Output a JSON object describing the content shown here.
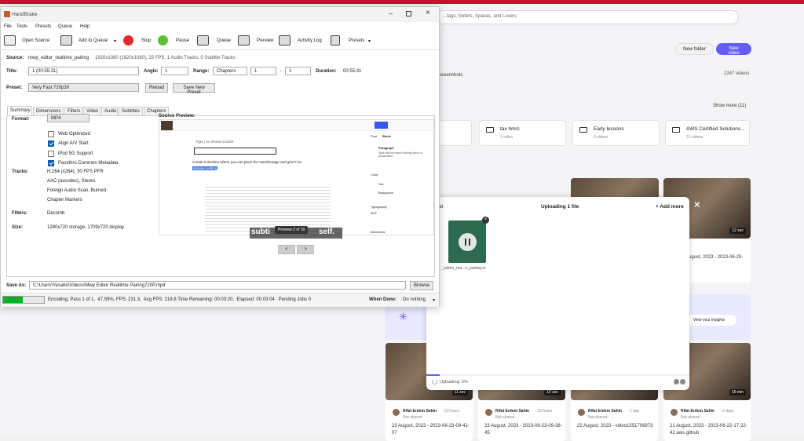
{
  "bg": {
    "search_placeholder": "...tags, folders, Spaces, and Lovers",
    "new_folder": "New folder",
    "new_video": "New video",
    "screenshots_label": "creenshots",
    "videos_count": "2247 videos",
    "show_more": "Show more (11)",
    "folders": [
      {
        "name": "tax hmrc",
        "sub": "1 video"
      },
      {
        "name": "Early lessons",
        "sub": "0 videos"
      },
      {
        "name": "AWS Certified Solutions...",
        "sub": "21 videos"
      }
    ],
    "insights": "View your insights",
    "mid_cards": [
      {
        "dur": "12 sec",
        "date": "August, 2023 - 2023-06-23-"
      }
    ],
    "bottom_cards": [
      {
        "dur": "11 sec",
        "author": "Rifat Erdem Sahin",
        "ago": "· 23 hours",
        "shared": "Not shared",
        "title": "23 August, 2023 - 2023-06-23-09-42-07"
      },
      {
        "dur": "10 sec",
        "author": "Rifat Erdem Sahin",
        "ago": "· 23 hours",
        "shared": "Not shared",
        "title": "23 August, 2023 - 2023-06-23-09-38-45"
      },
      {
        "dur": "",
        "author": "Rifat Erdem Sahin",
        "ago": "· 1 day",
        "shared": "Not shared",
        "title": "22 August, 2023 - video1551706973"
      },
      {
        "dur": "16 min",
        "author": "Rifat Erdem Sahin",
        "ago": "· 2 days",
        "shared": "Not shared",
        "title": "21 August, 2023 - 2023-06-22-17-22-42 aws github"
      }
    ]
  },
  "upload": {
    "cancel": "cel",
    "title": "Uploading 1 file",
    "add_more": "+ Add more",
    "filename": "_editor_rea...e_pairing.m",
    "status": "Uploading: 5%",
    "progress": 0.05,
    "close": "×"
  },
  "hb": {
    "title": "HandBrake",
    "menu": [
      "File",
      "Tools",
      "Presets",
      "Queue",
      "Help"
    ],
    "toolbar": {
      "open_source": "Open Source",
      "add_to_queue": "Add to Queue",
      "stop": "Stop",
      "pause": "Pause",
      "queue": "Queue",
      "preview": "Preview",
      "activity_log": "Activity Log",
      "presets": "Presets"
    },
    "source_label": "Source:",
    "source_name": "mwp_editor_realtime_pairing",
    "source_info": "1920x1080 (1920x1080), 25 FPS, 1 Audio Tracks, 0 Subtitle Tracks",
    "title_label": "Title:",
    "title_value": "1 (00:55:31)",
    "angle_label": "Angle:",
    "angle_value": "1",
    "range_label": "Range:",
    "range_type": "Chapters",
    "range_from": "1",
    "range_dash": "-",
    "range_to": "1",
    "duration_label": "Duration:",
    "duration_value": "00:55:31",
    "preset_label": "Preset:",
    "preset_value": "Very Fast 720p30",
    "reload": "Reload",
    "save_new_preset": "Save New Preset",
    "tabs": [
      "Summary",
      "Dimensions",
      "Filters",
      "Video",
      "Audio",
      "Subtitles",
      "Chapters"
    ],
    "format_label": "Format:",
    "format_value": "MP4",
    "checks": [
      {
        "label": "Web Optimized",
        "on": false
      },
      {
        "label": "Align A/V Start",
        "on": true
      },
      {
        "label": "iPod 5G Support",
        "on": false
      },
      {
        "label": "Passthru Common Metadata",
        "on": true
      }
    ],
    "tracks_label": "Tracks:",
    "tracks": [
      "H.264 (x264), 30 FPS PFR",
      "AAC (avcodec), Stereo",
      "Foreign Audio Scan, Burned",
      "Chapter Markers"
    ],
    "filters_label": "Filters:",
    "filters_value": "Decomb",
    "size_label": "Size:",
    "size_value": "1280x720 storage, 1709x720 display",
    "source_preview_label": "Source Preview:",
    "preview_badge": "Preview 2 of 10",
    "preview_subtitle": "subti",
    "preview_subtitle2": "self.",
    "doc_heading": "Create a timeline where you can place the stockfootage and give it for",
    "doc_highlight": "detailed editing",
    "doc_placeholder": "Type / to choose a block",
    "panel_tabs": [
      "Post",
      "Block"
    ],
    "panel_paragraph": "Paragraph",
    "panel_desc": "Start with the basic building block of all narrative.",
    "panel_color": "Color",
    "panel_text": "Text",
    "panel_background": "Background",
    "panel_typography": "Typography",
    "panel_size": "SIZE",
    "panel_dimensions": "Dimensions",
    "prev_btn": "<",
    "next_btn": ">",
    "save_as_label": "Save As:",
    "save_as_value": "C:\\Users\\Yesabo\\Videos\\Mwp Editor Realtime Pairing720P.mp4",
    "browse": "Browse",
    "progress": 0.4759,
    "status": "Encoding: Pass 1 of 1,  47.59%, FPS: 231.3,  Avg FPS: 218.8 Time Remaining: 00:03:20,  Elapsed: 00:03:04   Pending Jobs 0",
    "when_done_label": "When Done:",
    "when_done_value": "Do nothing"
  }
}
